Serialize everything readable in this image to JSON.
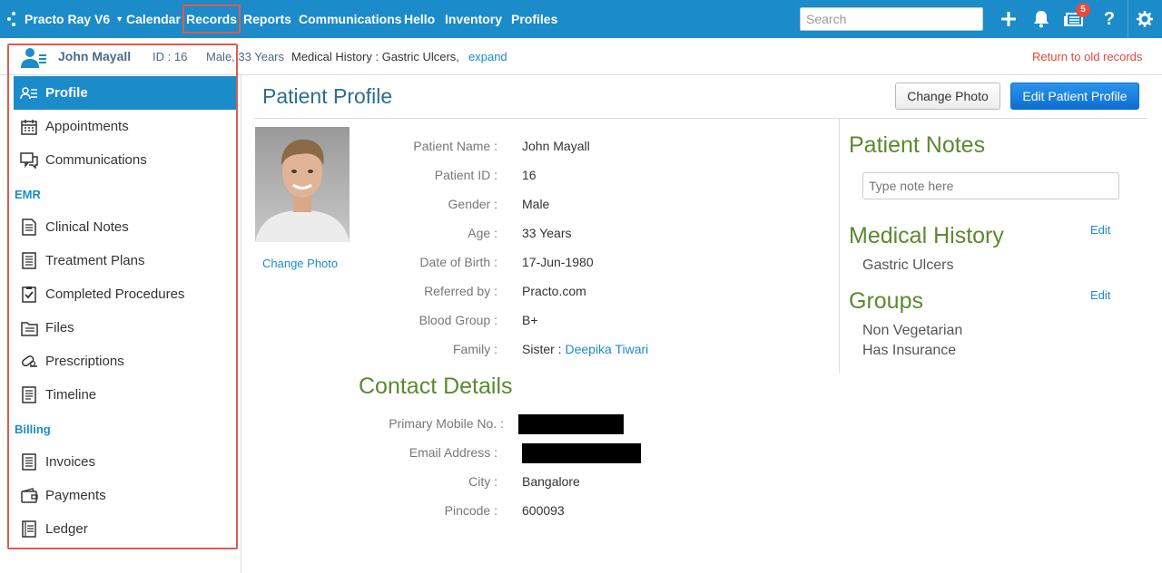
{
  "nav": {
    "brand": "Practo Ray V6",
    "items": [
      {
        "label": "Calendar"
      },
      {
        "label": "Records"
      },
      {
        "label": "Reports"
      },
      {
        "label": "Communications"
      },
      {
        "label": "Hello"
      },
      {
        "label": "Inventory"
      },
      {
        "label": "Profiles"
      }
    ],
    "search_placeholder": "Search",
    "notification_count": "5"
  },
  "patient_strip": {
    "name": "John Mayall",
    "id": "ID : 16",
    "meta": "Male, 33 Years",
    "history": "Medical History : Gastric Ulcers,",
    "expand": "expand",
    "return": "Return to old records"
  },
  "sidebar": {
    "items": [
      {
        "label": "Profile",
        "icon": "profile-card-icon"
      },
      {
        "label": "Appointments",
        "icon": "calendar-icon"
      },
      {
        "label": "Communications",
        "icon": "chat-icon"
      }
    ],
    "emr_title": "EMR",
    "emr_items": [
      {
        "label": "Clinical Notes",
        "icon": "notes-icon"
      },
      {
        "label": "Treatment Plans",
        "icon": "document-icon"
      },
      {
        "label": "Completed Procedures",
        "icon": "checklist-icon"
      },
      {
        "label": "Files",
        "icon": "files-icon"
      },
      {
        "label": "Prescriptions",
        "icon": "pill-icon"
      },
      {
        "label": "Timeline",
        "icon": "timeline-icon"
      }
    ],
    "billing_title": "Billing",
    "billing_items": [
      {
        "label": "Invoices",
        "icon": "invoice-icon"
      },
      {
        "label": "Payments",
        "icon": "wallet-icon"
      },
      {
        "label": "Ledger",
        "icon": "ledger-icon"
      }
    ]
  },
  "main": {
    "title": "Patient Profile",
    "change_photo_btn": "Change Photo",
    "edit_profile_btn": "Edit Patient Profile",
    "change_photo_link": "Change Photo",
    "fields": [
      {
        "label": "Patient Name :",
        "value": "John Mayall"
      },
      {
        "label": "Patient ID :",
        "value": "16"
      },
      {
        "label": "Gender :",
        "value": "Male"
      },
      {
        "label": "Age :",
        "value": "33 Years"
      },
      {
        "label": "Date of Birth :",
        "value": "17-Jun-1980"
      },
      {
        "label": "Referred by :",
        "value": "Practo.com"
      },
      {
        "label": "Blood Group :",
        "value": "B+"
      },
      {
        "label": "Family :",
        "value": "Sister :",
        "link": "Deepika Tiwari"
      }
    ],
    "contact_title": "Contact Details",
    "contact_fields": [
      {
        "label": "Primary Mobile No. :",
        "value": ""
      },
      {
        "label": "Email Address :",
        "value": ""
      },
      {
        "label": "City :",
        "value": "Bangalore"
      },
      {
        "label": "Pincode :",
        "value": "600093"
      }
    ]
  },
  "right_panel": {
    "notes_title": "Patient Notes",
    "notes_placeholder": "Type note here",
    "history_title": "Medical History",
    "history_edit": "Edit",
    "history_items": [
      "Gastric Ulcers"
    ],
    "groups_title": "Groups",
    "groups_edit": "Edit",
    "groups_items": [
      "Non Vegetarian",
      "Has Insurance"
    ]
  },
  "colors": {
    "topbar": "#1c8bc9",
    "accent_green": "#5a8a2e",
    "highlight_red": "#e05a4f"
  }
}
